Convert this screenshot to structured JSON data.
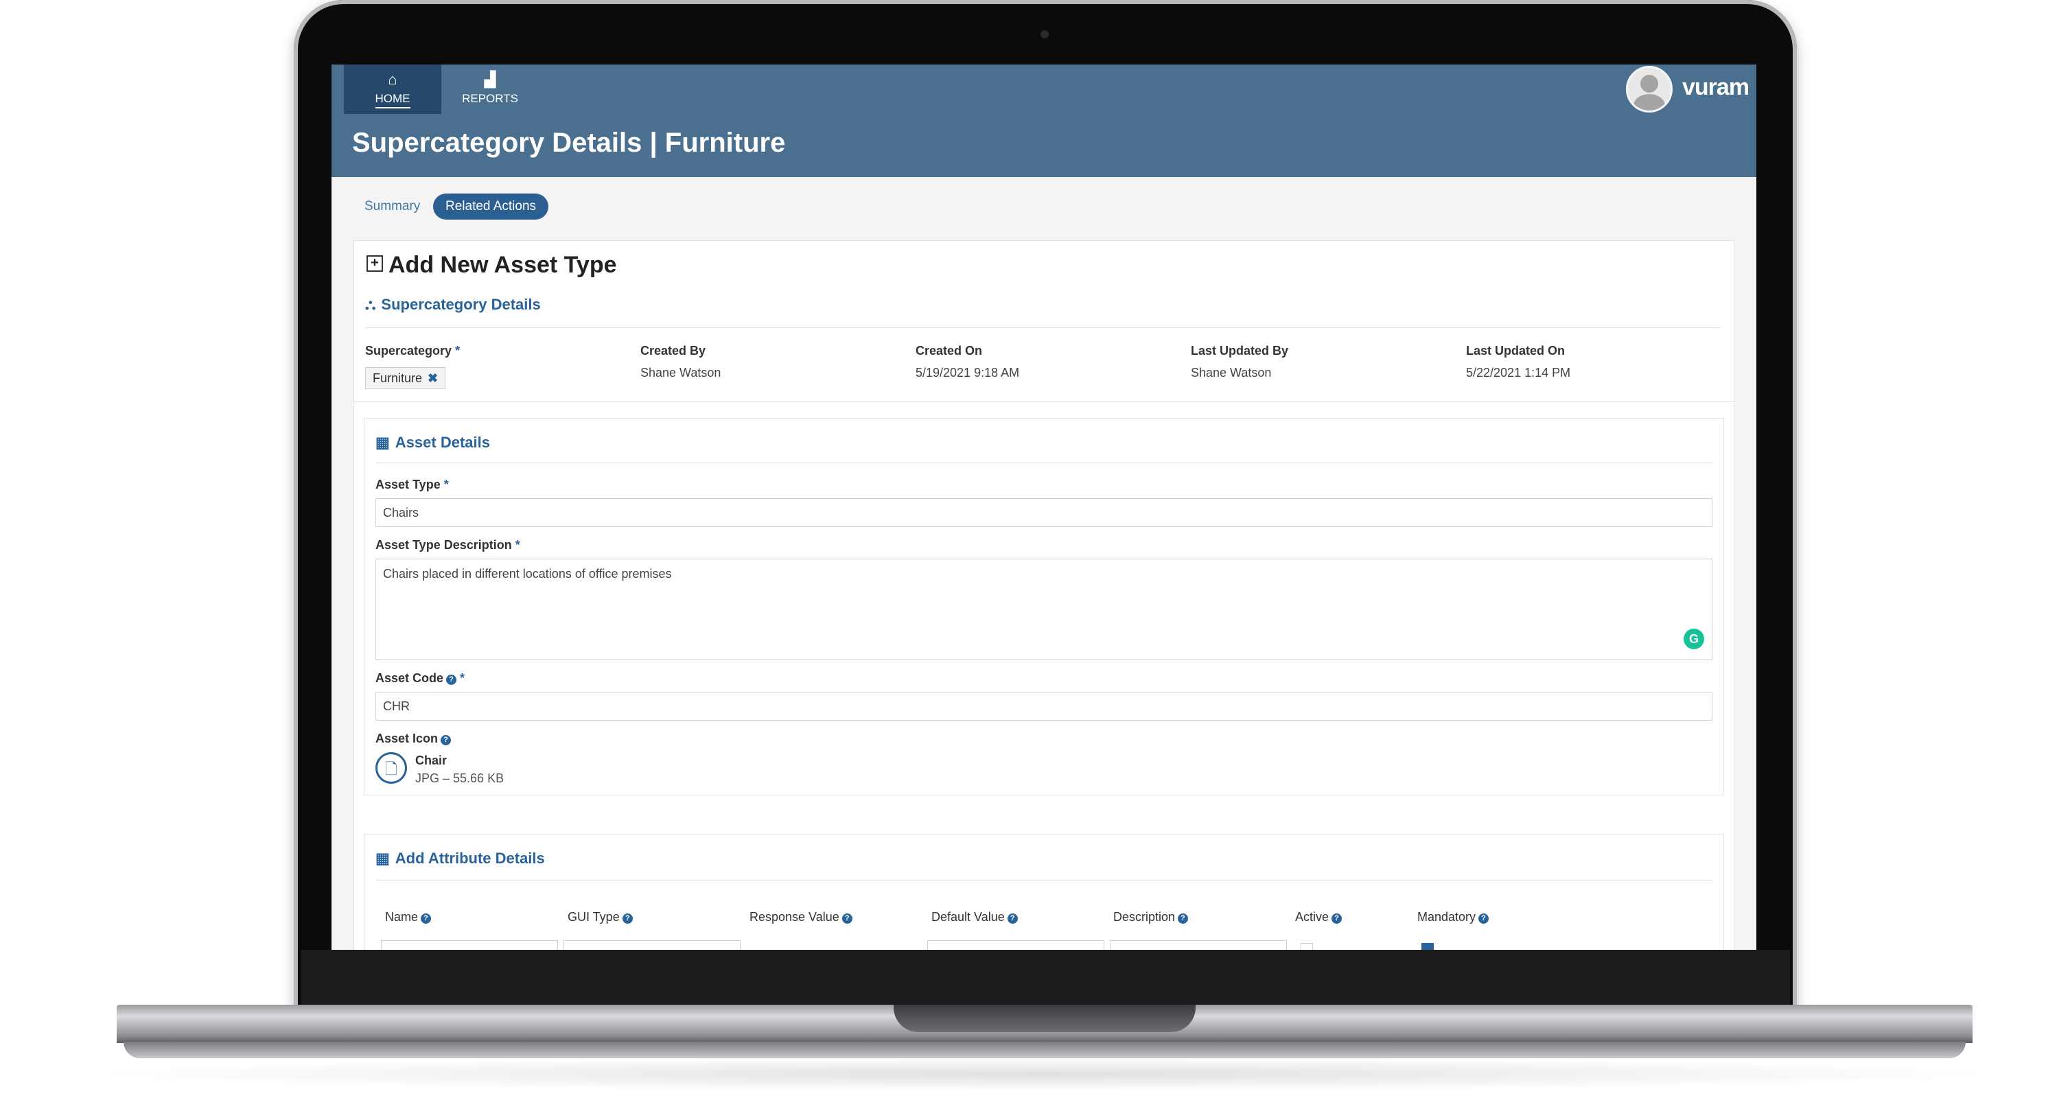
{
  "nav": {
    "home_label": "HOME",
    "home_icon": "home-icon",
    "reports_label": "REPORTS",
    "reports_icon": "chart-icon"
  },
  "header": {
    "title": "Supercategory Details | Furniture",
    "logo_text": "vuram"
  },
  "tabs": {
    "summary": "Summary",
    "related_actions": "Related Actions"
  },
  "card": {
    "title": "Add New Asset Type"
  },
  "supercategory_section": {
    "title": "Supercategory Details",
    "supercategory_label": "Supercategory",
    "required_mark": "*",
    "supercategory_value": "Furniture",
    "remove_mark": "✖",
    "created_by_label": "Created By",
    "created_by_value": "Shane Watson",
    "created_on_label": "Created On",
    "created_on_value": "5/19/2021 9:18 AM",
    "last_updated_by_label": "Last Updated By",
    "last_updated_by_value": "Shane Watson",
    "last_updated_on_label": "Last Updated On",
    "last_updated_on_value": "5/22/2021 1:14 PM"
  },
  "asset_details": {
    "title": "Asset Details",
    "asset_type_label": "Asset Type",
    "asset_type_value": "Chairs",
    "description_label": "Asset Type Description",
    "description_value": "Chairs placed in different locations of office premises",
    "asset_code_label": "Asset Code",
    "asset_code_value": "CHR",
    "asset_icon_label": "Asset Icon",
    "file_name": "Chair",
    "file_meta": "JPG – 55.66 KB"
  },
  "attributes": {
    "title": "Add Attribute Details",
    "columns": [
      "Name",
      "GUI Type",
      "Response Value",
      "Default Value",
      "Description",
      "Active",
      "Mandatory"
    ]
  },
  "colors": {
    "header_bg": "#4a6f8f",
    "accent": "#2a639a",
    "active_nav": "#26496b"
  }
}
